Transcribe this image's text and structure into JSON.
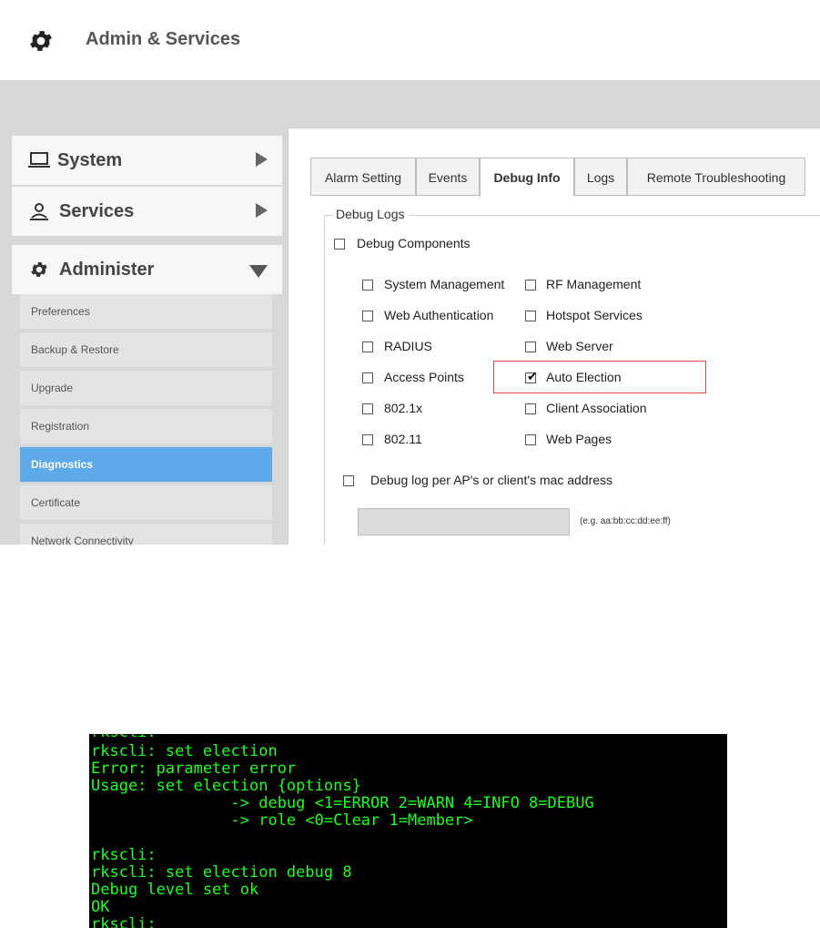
{
  "header": {
    "title": "Admin & Services",
    "icon": "gear-icon"
  },
  "sidebar": {
    "sections": [
      {
        "label": "System",
        "icon": "monitor-icon",
        "expanded": false
      },
      {
        "label": "Services",
        "icon": "services-icon",
        "expanded": false
      },
      {
        "label": "Administer",
        "icon": "gear-icon",
        "expanded": true
      }
    ],
    "items": [
      {
        "label": "Preferences",
        "active": false
      },
      {
        "label": "Backup & Restore",
        "active": false
      },
      {
        "label": "Upgrade",
        "active": false
      },
      {
        "label": "Registration",
        "active": false
      },
      {
        "label": "Diagnostics",
        "active": true
      },
      {
        "label": "Certificate",
        "active": false
      },
      {
        "label": "Network Connectivity",
        "active": false
      }
    ]
  },
  "tabs": [
    {
      "label": "Alarm Setting",
      "active": false
    },
    {
      "label": "Events",
      "active": false
    },
    {
      "label": "Debug Info",
      "active": true
    },
    {
      "label": "Logs",
      "active": false
    },
    {
      "label": "Remote Troubleshooting",
      "active": false
    }
  ],
  "debug_logs": {
    "legend": "Debug Logs",
    "debug_components": {
      "label": "Debug Components",
      "checked": false
    },
    "components": [
      {
        "label": "System Management",
        "checked": false
      },
      {
        "label": "RF Management",
        "checked": false
      },
      {
        "label": "Web Authentication",
        "checked": false
      },
      {
        "label": "Hotspot Services",
        "checked": false
      },
      {
        "label": "RADIUS",
        "checked": false
      },
      {
        "label": "Web Server",
        "checked": false
      },
      {
        "label": "Access Points",
        "checked": false
      },
      {
        "label": "Auto Election",
        "checked": true
      },
      {
        "label": "802.1x",
        "checked": false
      },
      {
        "label": "Client Association",
        "checked": false
      },
      {
        "label": "802.11",
        "checked": false
      },
      {
        "label": "Web Pages",
        "checked": false
      }
    ],
    "mac_debug": {
      "label": "Debug log per AP's or client's mac address",
      "checked": false
    },
    "mac_input": {
      "value": "",
      "hint": "(e.g. aa:bb:cc:dd:ee:ff)"
    }
  },
  "colors": {
    "terminal_text": "#1cff1c",
    "active_item": "#5da9e9",
    "highlight_border": "#e34949"
  },
  "terminal": {
    "lines": [
      "rkscli:",
      "rkscli: set election",
      "Error: parameter error",
      "Usage: set election {options}",
      "               -> debug <1=ERROR 2=WARN 4=INFO 8=DEBUG",
      "               -> role <0=Clear 1=Member>",
      "",
      "rkscli:",
      "rkscli: set election debug 8",
      "Debug level set ok",
      "OK",
      "rkscli:"
    ]
  }
}
